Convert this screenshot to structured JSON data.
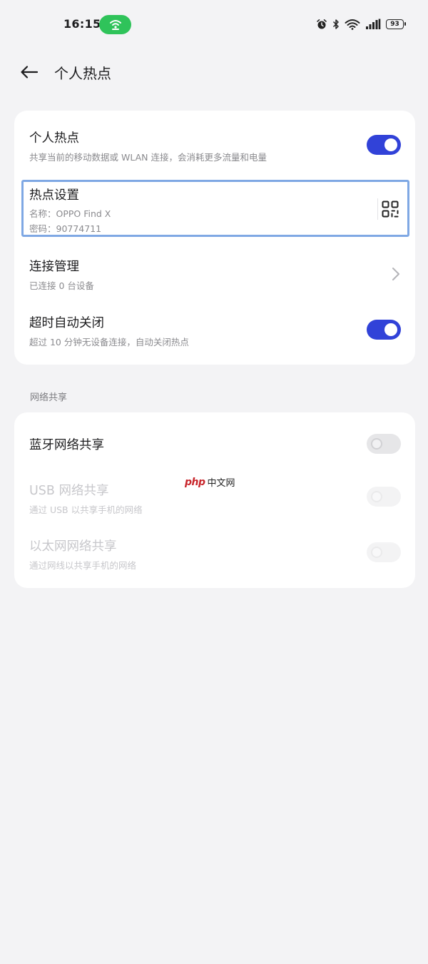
{
  "status_bar": {
    "time": "16:15",
    "battery": "93",
    "icons": [
      "hotspot-icon",
      "alarm-icon",
      "bluetooth-icon",
      "wifi-icon",
      "signal-icon",
      "battery-icon"
    ]
  },
  "header": {
    "title": "个人热点"
  },
  "main_card": {
    "hotspot": {
      "title": "个人热点",
      "subtitle": "共享当前的移动数据或 WLAN 连接，会消耗更多流量和电量",
      "enabled": true
    },
    "settings": {
      "title": "热点设置",
      "name_line": "名称：OPPO Find X",
      "password_line": "密码：90774711"
    },
    "connections": {
      "title": "连接管理",
      "subtitle": "已连接 0 台设备"
    },
    "timeout": {
      "title": "超时自动关闭",
      "subtitle": "超过 10 分钟无设备连接，自动关闭热点",
      "enabled": true
    }
  },
  "sharing_section": {
    "label": "网络共享",
    "items": [
      {
        "title": "蓝牙网络共享",
        "subtitle": "",
        "enabled": false,
        "disabled": false
      },
      {
        "title": "USB 网络共享",
        "subtitle": "通过 USB 以共享手机的网络",
        "enabled": false,
        "disabled": true
      },
      {
        "title": "以太网网络共享",
        "subtitle": "通过网线以共享手机的网络",
        "enabled": false,
        "disabled": true
      }
    ]
  },
  "watermark": {
    "logo": "php",
    "text": "中文网"
  },
  "colors": {
    "accent": "#3142d8",
    "hotspot_pill": "#2fc35a",
    "background": "#f3f3f5",
    "focus_outline": "#7fa8e4"
  }
}
